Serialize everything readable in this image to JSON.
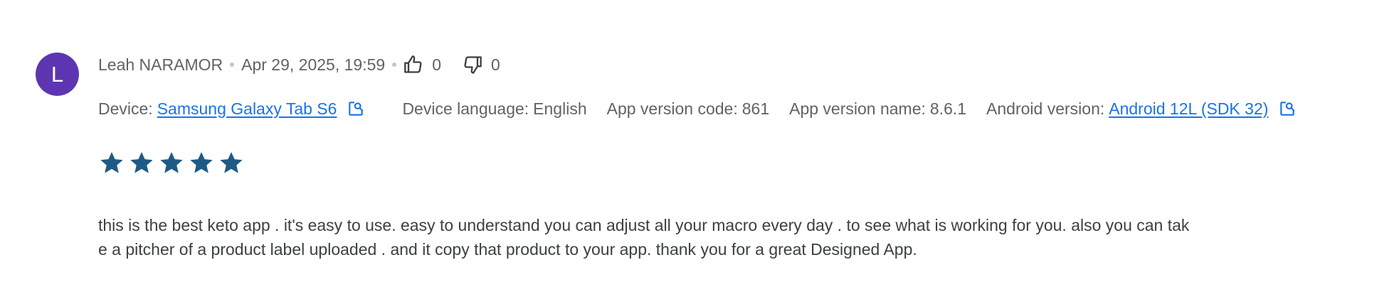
{
  "review": {
    "avatar_letter": "L",
    "avatar_color": "#5e35b1",
    "author": "Leah NARAMOR",
    "date": "Apr 29, 2025, 19:59",
    "thumbs_up_count": "0",
    "thumbs_down_count": "0",
    "rating": 5,
    "star_color": "#1f5a85",
    "text": "this is the best keto app . it's easy to use. easy to understand you can adjust all your macro every day . to see what is working for you. also you can take a pitcher of a product label uploaded . and it copy that product to your app. thank you for a great Designed App."
  },
  "device_info": {
    "device_label": "Device:",
    "device_value": "Samsung Galaxy Tab S6",
    "language_label": "Device language:",
    "language_value": "English",
    "version_code_label": "App version code:",
    "version_code_value": "861",
    "version_name_label": "App version name:",
    "version_name_value": "8.6.1",
    "android_label": "Android version:",
    "android_value": "Android 12L (SDK 32)"
  },
  "colors": {
    "link": "#1a73e8",
    "secondary_text": "#5f6368",
    "body_text": "#3c4043"
  },
  "icons": [
    "thumb-up-icon",
    "thumb-down-icon",
    "open-in-new-icon",
    "star-icon"
  ]
}
